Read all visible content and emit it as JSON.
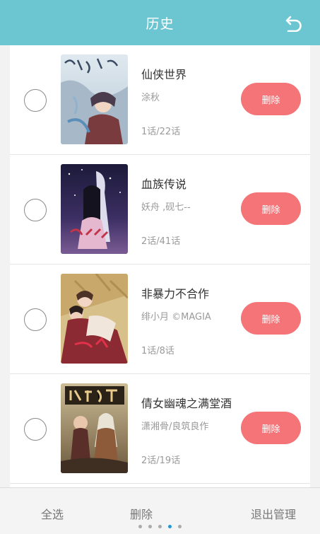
{
  "header": {
    "title": "历史",
    "back_icon": "undo-arrow-icon"
  },
  "items": [
    {
      "title": "仙侠世界",
      "author": "涂秋",
      "progress": "1话/22话",
      "delete_label": "删除",
      "selected": false
    },
    {
      "title": "血族传说",
      "author": "妖舟 ,砚七--",
      "progress": "2话/41话",
      "delete_label": "删除",
      "selected": false
    },
    {
      "title": "非暴力不合作",
      "author": "绯小月 ©MAGIA",
      "progress": "1话/8话",
      "delete_label": "删除",
      "selected": false
    },
    {
      "title": "倩女幽魂之满堂酒",
      "author": "潇湘骨/良筑良作",
      "progress": "2话/19话",
      "delete_label": "删除",
      "selected": false
    }
  ],
  "footer": {
    "select_all": "全选",
    "delete": "删除",
    "exit_manage": "退出管理"
  },
  "pager": {
    "count": 5,
    "active_index": 3
  },
  "colors": {
    "header_bg": "#6cc6d1",
    "delete_button": "#f57478",
    "active_dot": "#2196d8"
  }
}
